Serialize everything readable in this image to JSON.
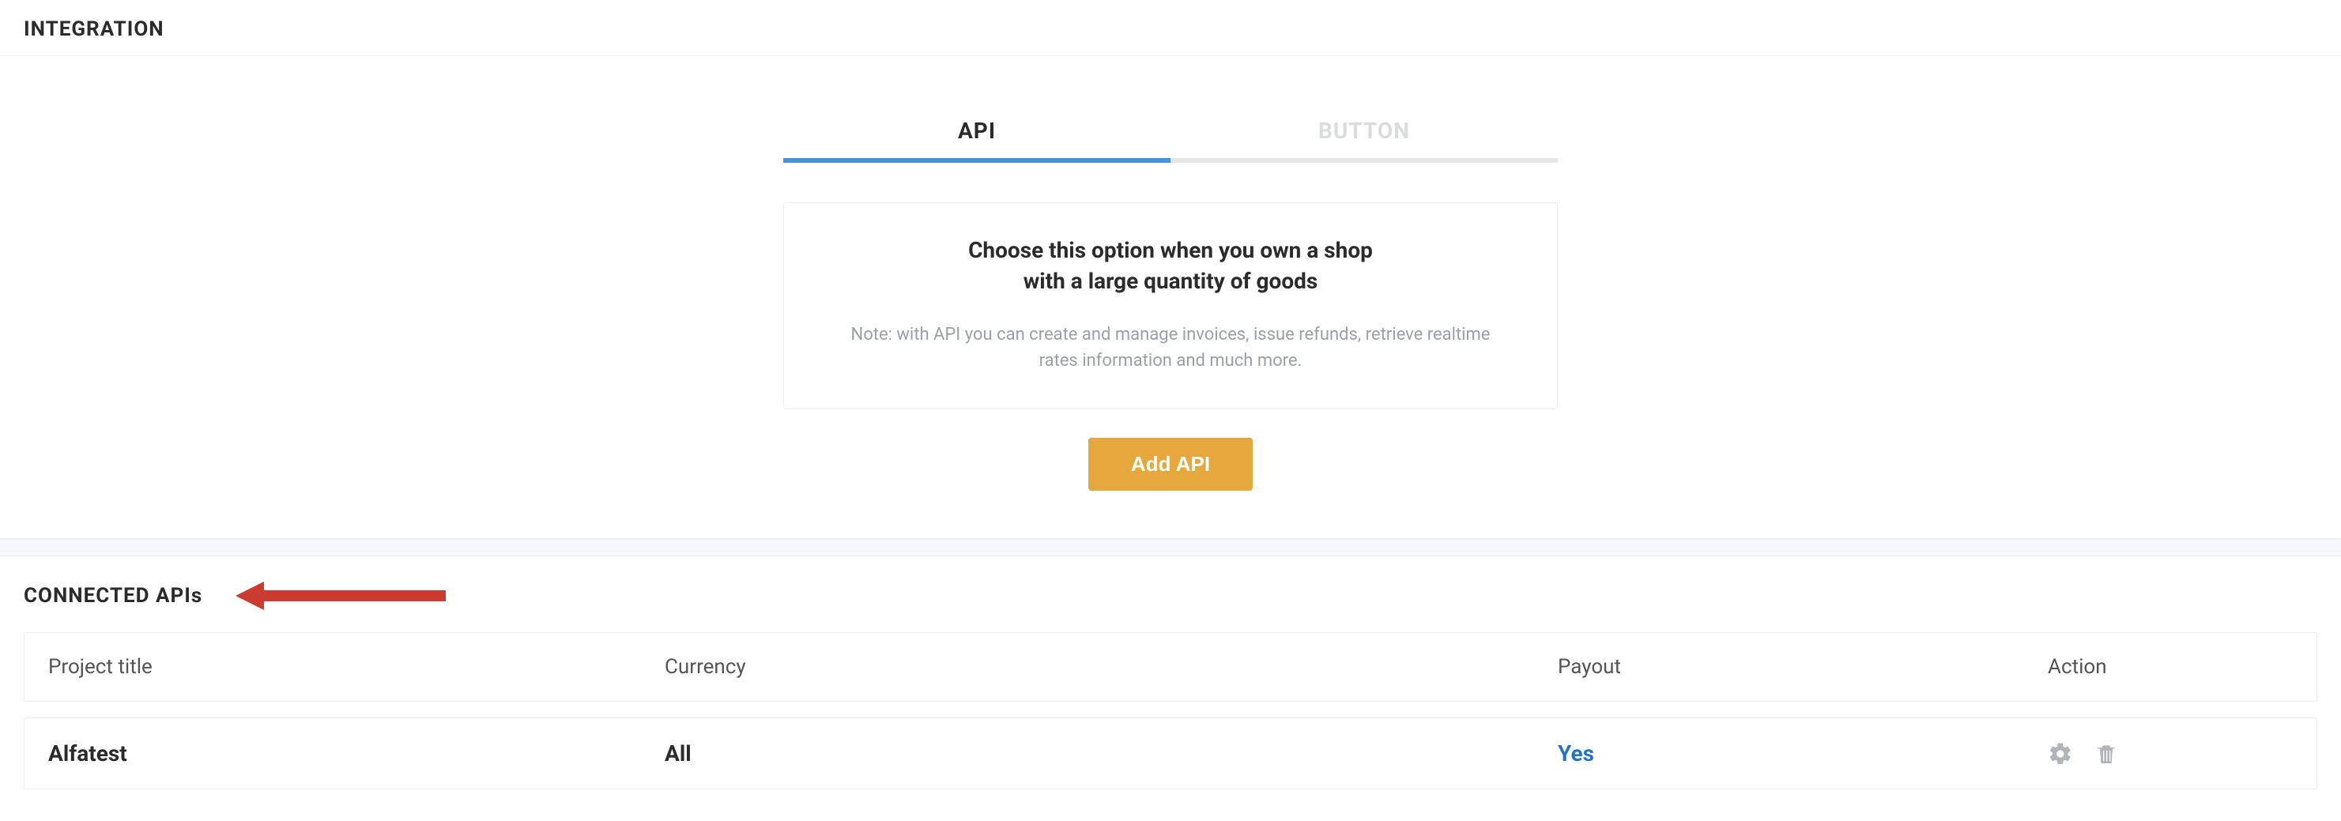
{
  "integration": {
    "header": "INTEGRATION",
    "tabs": {
      "api": "API",
      "button": "BUTTON"
    },
    "card": {
      "title_line1": "Choose this option when you own a shop",
      "title_line2": "with a large quantity of goods",
      "note_line1": "Note: with API you can create and manage invoices, issue refunds, retrieve realtime",
      "note_line2": "rates information and much more."
    },
    "add_button": "Add API"
  },
  "connected": {
    "header": "CONNECTED APIs",
    "columns": {
      "project_title": "Project title",
      "currency": "Currency",
      "payout": "Payout",
      "action": "Action"
    },
    "rows": [
      {
        "project_title": "Alfatest",
        "currency": "All",
        "payout": "Yes"
      }
    ]
  },
  "icons": {
    "gear": "gear-icon",
    "trash": "trash-icon"
  }
}
